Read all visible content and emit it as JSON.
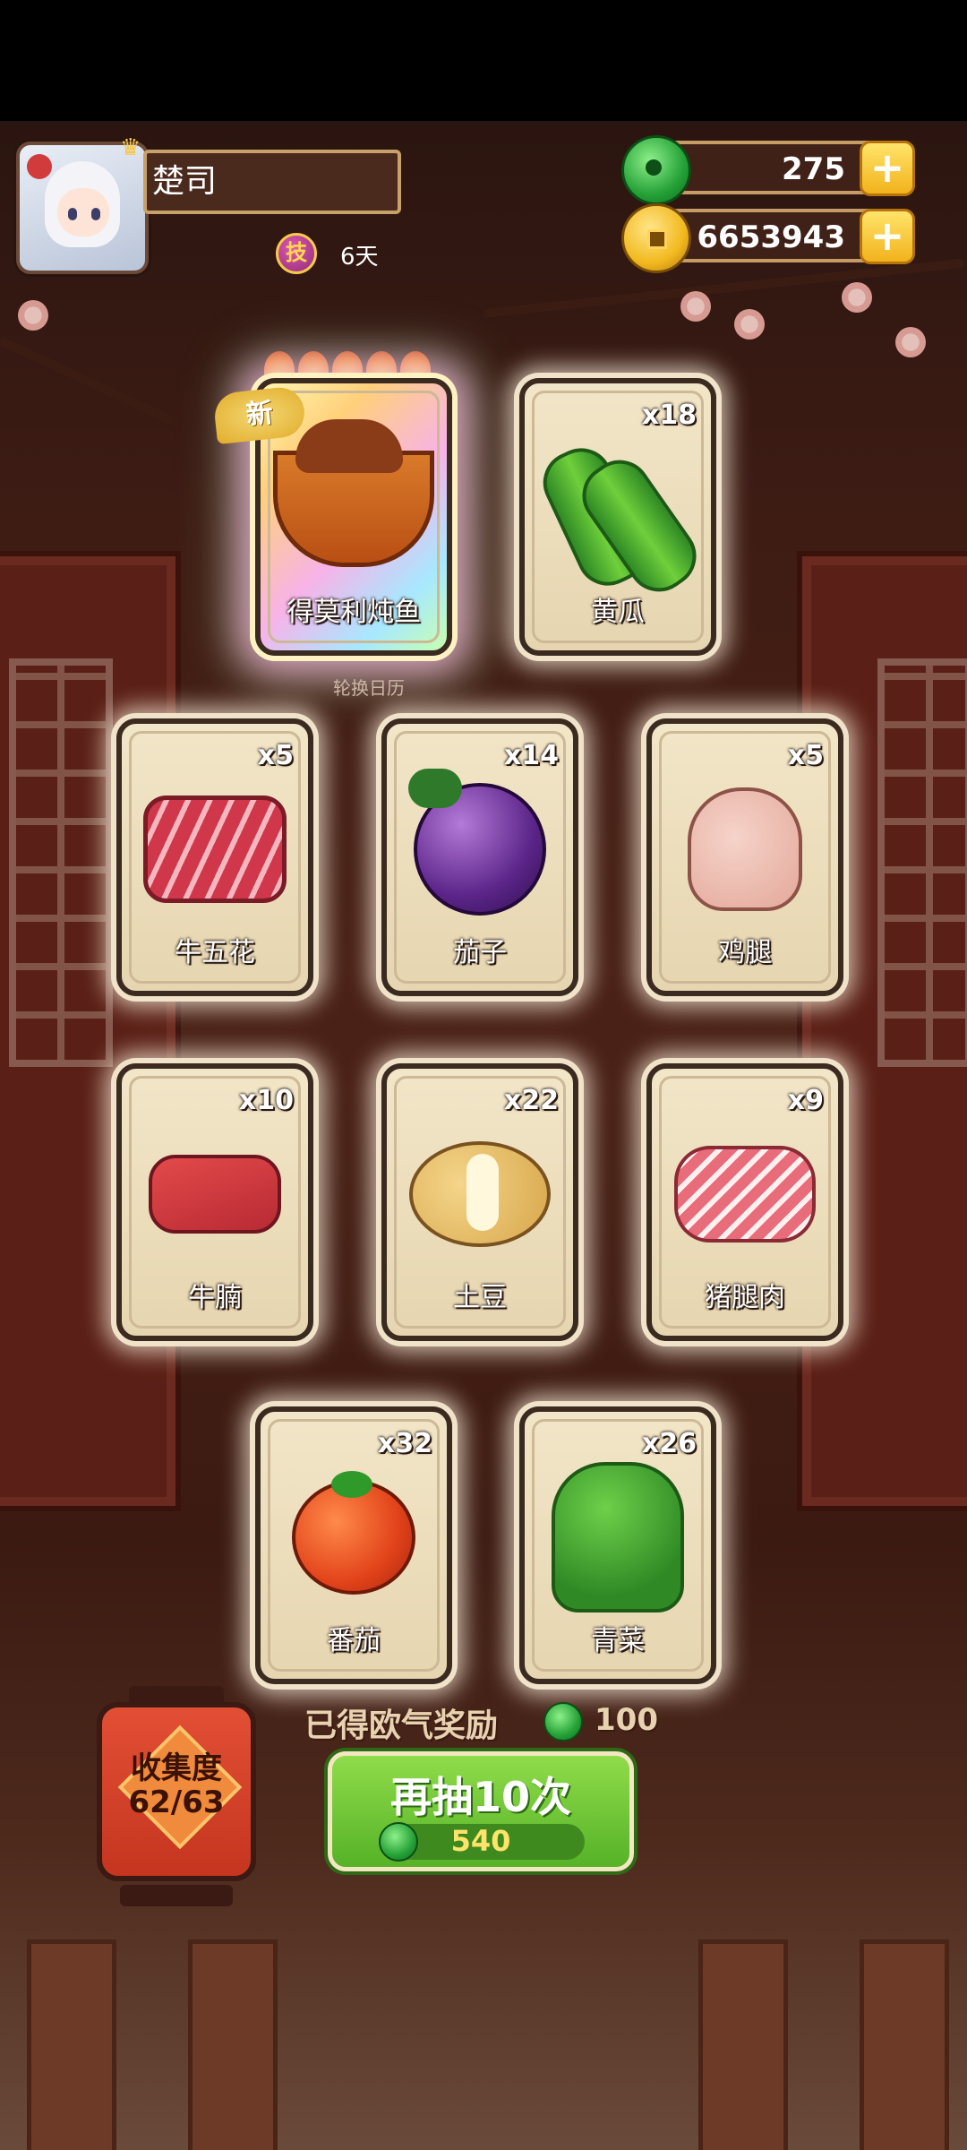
{
  "player": {
    "name": "楚司",
    "skill_badge": "技",
    "skill_days": "6天"
  },
  "currency": {
    "jade": "275",
    "coins": "6653943"
  },
  "featured": {
    "new_tag": "新",
    "calendar_label": "轮换日历"
  },
  "cards": [
    {
      "name": "得莫利炖鱼",
      "count": "",
      "icon": "stewed-fish-icon",
      "new": true
    },
    {
      "name": "黄瓜",
      "count": "x18",
      "icon": "cucumber-icon"
    },
    {
      "name": "牛五花",
      "count": "x5",
      "icon": "beef-belly-icon"
    },
    {
      "name": "茄子",
      "count": "x14",
      "icon": "eggplant-icon"
    },
    {
      "name": "鸡腿",
      "count": "x5",
      "icon": "drumstick-icon"
    },
    {
      "name": "牛腩",
      "count": "x10",
      "icon": "brisket-icon"
    },
    {
      "name": "土豆",
      "count": "x22",
      "icon": "potato-icon"
    },
    {
      "name": "猪腿肉",
      "count": "x9",
      "icon": "pork-leg-icon"
    },
    {
      "name": "番茄",
      "count": "x32",
      "icon": "tomato-icon"
    },
    {
      "name": "青菜",
      "count": "x26",
      "icon": "greens-icon"
    }
  ],
  "collection": {
    "title": "收集度",
    "value": "62/63"
  },
  "luck_reward": {
    "label": "已得欧气奖励",
    "value": "100"
  },
  "draw_button": {
    "label": "再抽10次",
    "cost": "540"
  },
  "colors": {
    "draw_green": "#56b227",
    "lantern_red": "#c5351f",
    "card_bg": "#f2e6c8"
  }
}
